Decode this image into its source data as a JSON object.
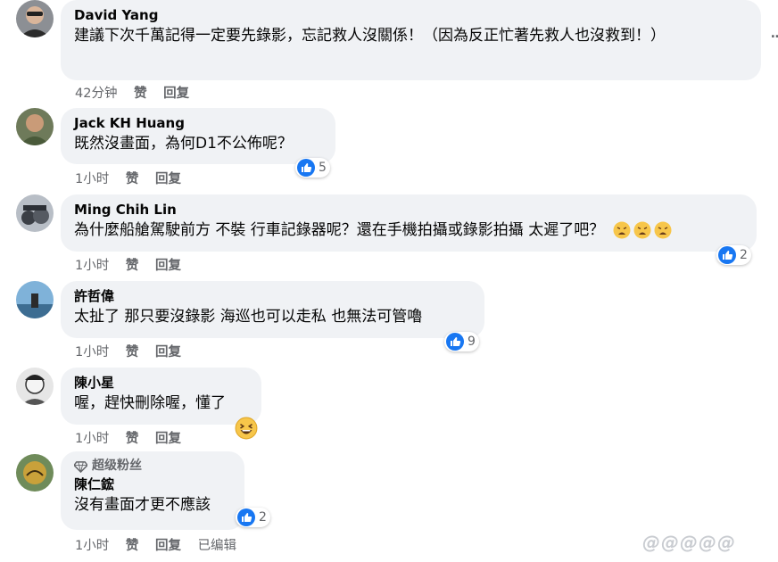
{
  "comments": [
    {
      "name": "David Yang",
      "text": "建議下次千萬記得一定要先錄影，忘記救人沒關係！（因為反正忙著先救人也沒救到！）",
      "time": "42分钟",
      "like_label": "赞",
      "reply_label": "回复"
    },
    {
      "name": "Jack KH Huang",
      "text": "既然沒畫面，為何D1不公佈呢？",
      "time": "1小时",
      "like_label": "赞",
      "reply_label": "回复",
      "reaction_count": "5"
    },
    {
      "name": "Ming Chih Lin",
      "text": "為什麼船艙駕駛前方 不裝 行車記錄器呢？還在手機拍攝或錄影拍攝 太遲了吧？",
      "time": "1小时",
      "like_label": "赞",
      "reply_label": "回复",
      "reaction_count": "2"
    },
    {
      "name": "許哲偉",
      "text": "太扯了 那只要沒錄影 海巡也可以走私 也無法可管嚕",
      "time": "1小时",
      "like_label": "赞",
      "reply_label": "回复",
      "reaction_count": "9"
    },
    {
      "name": "陳小星",
      "text": "喔，趕快刪除喔，懂了",
      "time": "1小时",
      "like_label": "赞",
      "reply_label": "回复"
    },
    {
      "badge": "超级粉丝",
      "name": "陳仁鋐",
      "text": "沒有畫面才更不應該",
      "time": "1小时",
      "like_label": "赞",
      "reply_label": "回复",
      "edited_label": "已编辑",
      "reaction_count": "2"
    }
  ],
  "more_options": "…",
  "watermark": "@@@@@",
  "colors": {
    "bubble": "#f0f2f5",
    "meta": "#65676b",
    "like_blue": "#1877f2"
  },
  "icons": [
    "like-reaction-icon",
    "weary-face-emoji-icon",
    "grinning-squint-emoji-icon",
    "diamond-badge-icon"
  ]
}
